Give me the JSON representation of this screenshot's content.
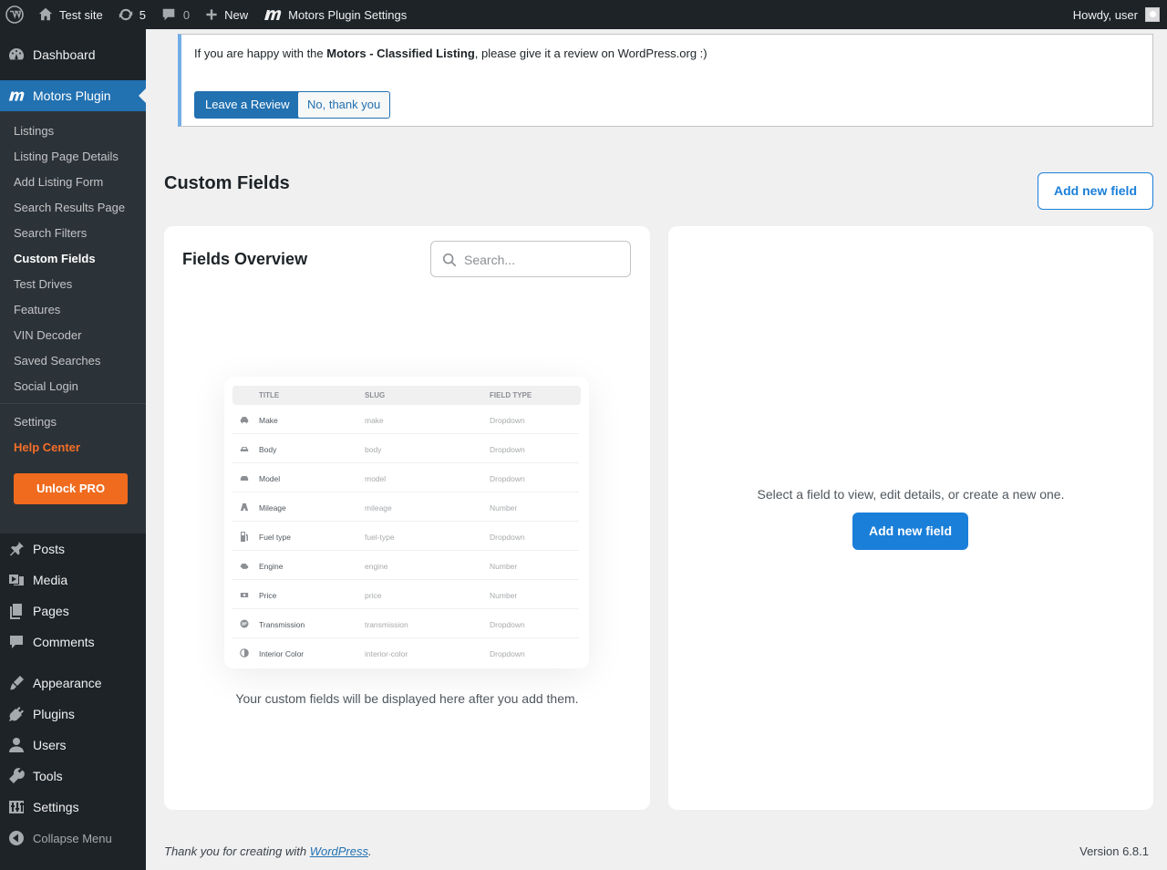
{
  "adminbar": {
    "site_name": "Test site",
    "updates_count": "5",
    "comments_count": "0",
    "new_label": "New",
    "plugin_settings_label": "Motors Plugin Settings",
    "howdy": "Howdy, user"
  },
  "sidebar": {
    "dashboard": "Dashboard",
    "motors_plugin": "Motors Plugin",
    "submenu": [
      "Listings",
      "Listing Page Details",
      "Add Listing Form",
      "Search Results Page",
      "Search Filters",
      "Custom Fields",
      "Test Drives",
      "Features",
      "VIN Decoder",
      "Saved Searches",
      "Social Login"
    ],
    "settings_sub": "Settings",
    "help_center": "Help Center",
    "unlock_pro": "Unlock PRO",
    "posts": "Posts",
    "media": "Media",
    "pages": "Pages",
    "comments": "Comments",
    "appearance": "Appearance",
    "plugins": "Plugins",
    "users": "Users",
    "tools": "Tools",
    "settings": "Settings",
    "collapse": "Collapse Menu"
  },
  "notice": {
    "text_before": "If you are happy with the ",
    "plugin_name": "Motors - Classified Listing",
    "text_after": ", please give it a review on WordPress.org :)",
    "review_button": "Leave a Review",
    "decline_button": "No, thank you"
  },
  "page": {
    "title": "Custom Fields",
    "add_new_field": "Add new field"
  },
  "fields_overview": {
    "title": "Fields Overview",
    "search_placeholder": "Search...",
    "empty_text": "Your custom fields will be displayed here after you add them.",
    "preview": {
      "headers": [
        "TITLE",
        "SLUG",
        "FIELD TYPE"
      ],
      "rows": [
        {
          "title": "Make",
          "slug": "make",
          "type": "Dropdown"
        },
        {
          "title": "Body",
          "slug": "body",
          "type": "Dropdown"
        },
        {
          "title": "Model",
          "slug": "model",
          "type": "Dropdown"
        },
        {
          "title": "Mileage",
          "slug": "mileage",
          "type": "Number"
        },
        {
          "title": "Fuel type",
          "slug": "fuel-type",
          "type": "Dropdown"
        },
        {
          "title": "Engine",
          "slug": "engine",
          "type": "Number"
        },
        {
          "title": "Price",
          "slug": "price",
          "type": "Number"
        },
        {
          "title": "Transmission",
          "slug": "transmission",
          "type": "Dropdown"
        },
        {
          "title": "Interior Color",
          "slug": "interior-color",
          "type": "Dropdown"
        }
      ]
    }
  },
  "details_panel": {
    "text": "Select a field to view, edit details, or create a new one.",
    "button": "Add new field"
  },
  "footer": {
    "thanks_before": "Thank you for creating with ",
    "wordpress_link": "WordPress",
    "thanks_after": ".",
    "version": "Version 6.8.1"
  },
  "colors": {
    "accent": "#2271b1",
    "plugin_blue": "#1a7fd9",
    "orange": "#f06b1e",
    "help_orange": "#f56e28",
    "admin_dark": "#1d2327"
  }
}
